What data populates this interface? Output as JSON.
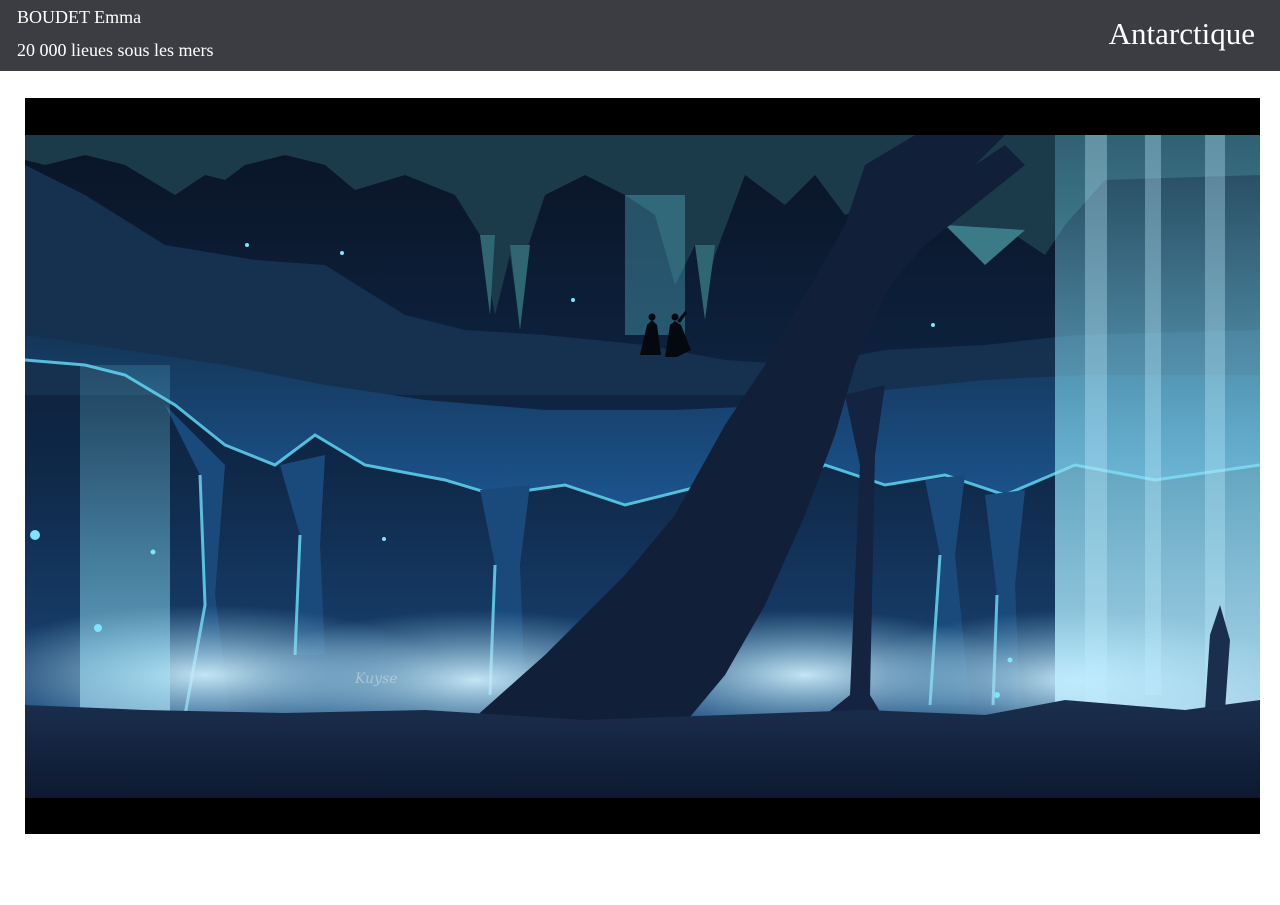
{
  "header": {
    "author": "BOUDET Emma",
    "work_title": "20 000 lieues sous les mers",
    "chapter": "Antarctique"
  },
  "artwork": {
    "signature": "Kuyse",
    "colors": {
      "header_bg": "#3b3d43",
      "letterbox": "#000000",
      "sky": "#0b1628",
      "ice_glow": "#5fd6f2",
      "mist": "#a9d9ee"
    }
  }
}
